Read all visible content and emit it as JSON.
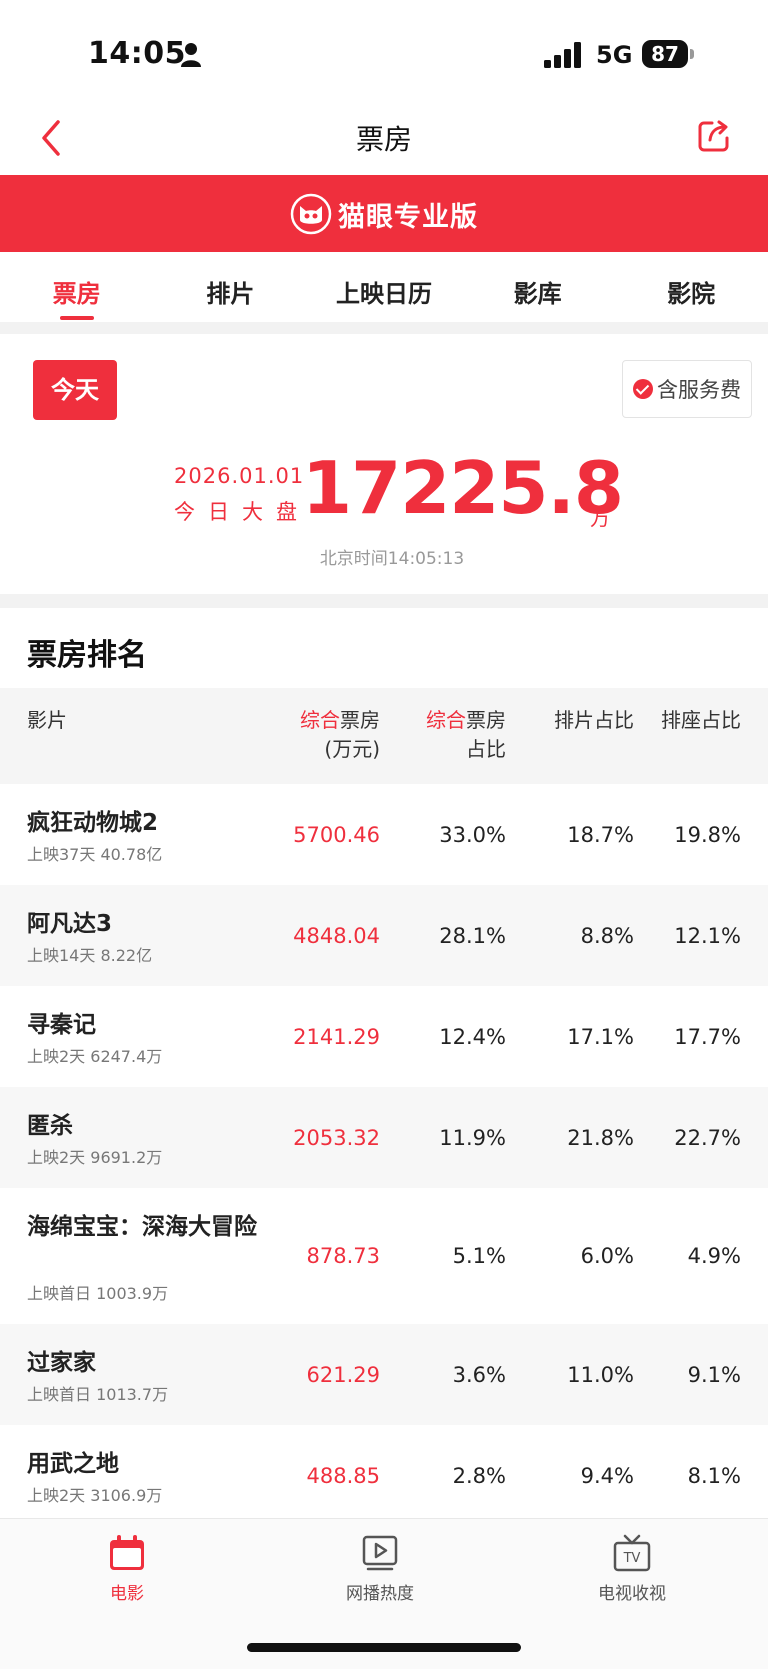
{
  "status_bar": {
    "time": "14:05",
    "network": "5G",
    "battery": "87"
  },
  "nav": {
    "title": "票房"
  },
  "brand": {
    "name": "猫眼专业版"
  },
  "tabs": [
    "票房",
    "排片",
    "上映日历",
    "影库",
    "影院"
  ],
  "summary": {
    "date_button": "今天",
    "fee_toggle": "含服务费",
    "fee_included": true,
    "date": "2026.01.01",
    "label": "今日大盘",
    "total": "17225.8",
    "unit": "万",
    "updated": "北京时间14:05:13"
  },
  "ranking": {
    "title": "票房排名",
    "headers": {
      "movie": "影片",
      "box_prefix": "综合",
      "box_main": "票房",
      "box_unit": "(万元)",
      "share_prefix": "综合",
      "share_main": "票房",
      "share_line2": "占比",
      "schedule": "排片占比",
      "seat": "排座占比"
    },
    "rows": [
      {
        "name": "疯狂动物城2",
        "sub": "上映37天  40.78亿",
        "box": "5700.46",
        "share": "33.0%",
        "schedule": "18.7%",
        "seat": "19.8%"
      },
      {
        "name": "阿凡达3",
        "sub": "上映14天  8.22亿",
        "box": "4848.04",
        "share": "28.1%",
        "schedule": "8.8%",
        "seat": "12.1%"
      },
      {
        "name": "寻秦记",
        "sub": "上映2天  6247.4万",
        "box": "2141.29",
        "share": "12.4%",
        "schedule": "17.1%",
        "seat": "17.7%"
      },
      {
        "name": "匿杀",
        "sub": "上映2天  9691.2万",
        "box": "2053.32",
        "share": "11.9%",
        "schedule": "21.8%",
        "seat": "22.7%"
      },
      {
        "name": "海绵宝宝：深海大冒险",
        "sub": "上映首日  1003.9万",
        "box": "878.73",
        "share": "5.1%",
        "schedule": "6.0%",
        "seat": "4.9%"
      },
      {
        "name": "过家家",
        "sub": "上映首日  1013.7万",
        "box": "621.29",
        "share": "3.6%",
        "schedule": "11.0%",
        "seat": "9.1%"
      },
      {
        "name": "用武之地",
        "sub": "上映2天  3106.9万",
        "box": "488.85",
        "share": "2.8%",
        "schedule": "9.4%",
        "seat": "8.1%"
      }
    ]
  },
  "bottom_nav": [
    {
      "label": "电影",
      "icon": "calendar-icon",
      "active": true
    },
    {
      "label": "网播热度",
      "icon": "play-icon",
      "active": false
    },
    {
      "label": "电视收视",
      "icon": "tv-icon",
      "active": false
    }
  ],
  "colors": {
    "accent": "#ef2f3d"
  }
}
